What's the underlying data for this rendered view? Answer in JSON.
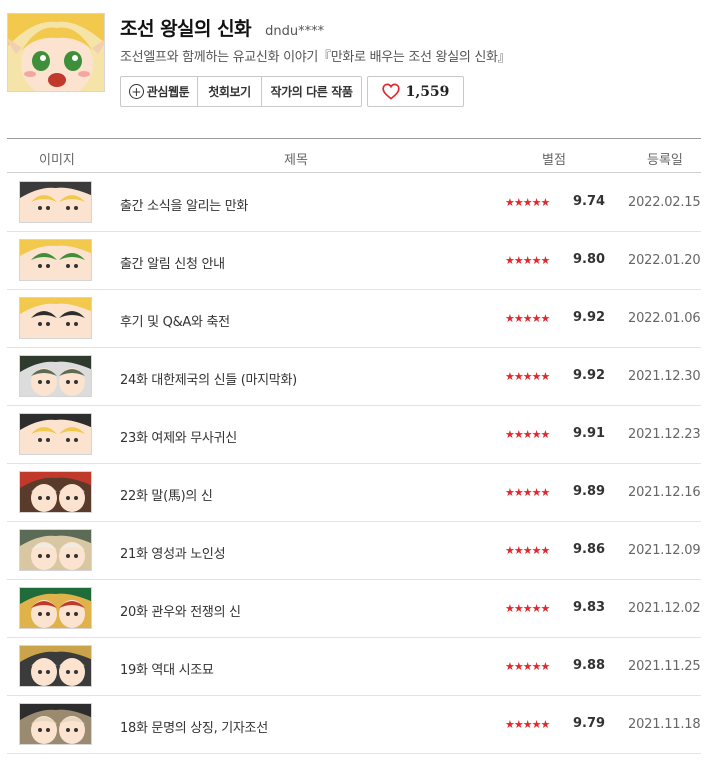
{
  "header": {
    "title": "조선 왕실의 신화",
    "author": "dndu****",
    "description": "조선엘프와 함께하는 유교신화 이야기『만화로 배우는 조선 왕실의 신화』",
    "buttons": {
      "favorite_label": "관심웹툰",
      "first_episode_label": "첫회보기",
      "other_works_label": "작가의 다른 작품"
    },
    "like_count": "1,559"
  },
  "table": {
    "headers": {
      "image": "이미지",
      "title": "제목",
      "rating": "별점",
      "date": "등록일"
    },
    "stars": "★★★★★",
    "rows": [
      {
        "title": "출간 소식을 알리는 만화",
        "score": "9.74",
        "date": "2022.02.15"
      },
      {
        "title": "출간 알림 신청 안내",
        "score": "9.80",
        "date": "2022.01.20"
      },
      {
        "title": "후기 및 Q&A와 축전",
        "score": "9.92",
        "date": "2022.01.06"
      },
      {
        "title": "24화 대한제국의 신들 (마지막화)",
        "score": "9.92",
        "date": "2021.12.30"
      },
      {
        "title": "23화 여제와 무사귀신",
        "score": "9.91",
        "date": "2021.12.23"
      },
      {
        "title": "22화 말(馬)의 신",
        "score": "9.89",
        "date": "2021.12.16"
      },
      {
        "title": "21화 영성과 노인성",
        "score": "9.86",
        "date": "2021.12.09"
      },
      {
        "title": "20화 관우와 전쟁의 신",
        "score": "9.83",
        "date": "2021.12.02"
      },
      {
        "title": "19화 역대 시조묘",
        "score": "9.88",
        "date": "2021.11.25"
      },
      {
        "title": "18화 문명의 상징, 기자조선",
        "score": "9.79",
        "date": "2021.11.18"
      }
    ]
  },
  "colors": {
    "star": "#e4262d",
    "heart": "#e4262d",
    "elf_hair": "#f2c94c",
    "border": "#c9c9c9"
  }
}
